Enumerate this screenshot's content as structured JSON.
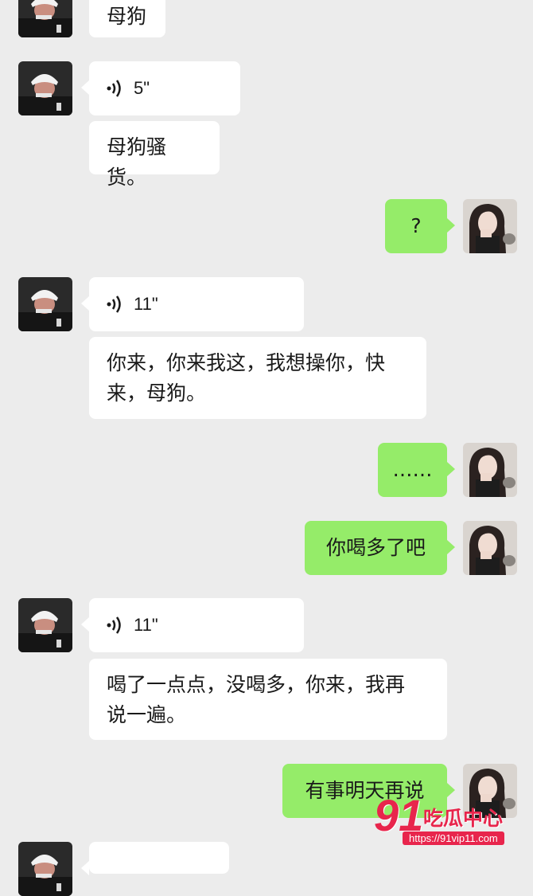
{
  "chat": {
    "messages": [
      {
        "sender": "other",
        "type": "text",
        "text": "母狗"
      },
      {
        "sender": "other",
        "type": "voice",
        "duration": "5\""
      },
      {
        "sender": "other",
        "type": "text",
        "text": "母狗骚货。"
      },
      {
        "sender": "self",
        "type": "text",
        "text": "?"
      },
      {
        "sender": "other",
        "type": "voice",
        "duration": "11\""
      },
      {
        "sender": "other",
        "type": "text",
        "line1": "你来，你来我这，我想操你，快",
        "line2": "来，母狗。"
      },
      {
        "sender": "self",
        "type": "text",
        "text": "……"
      },
      {
        "sender": "self",
        "type": "text",
        "text": "你喝多了吧"
      },
      {
        "sender": "other",
        "type": "voice",
        "duration": "11\""
      },
      {
        "sender": "other",
        "type": "text",
        "line1": "喝了一点点，没喝多，你来，我再",
        "line2": "说一遍。"
      },
      {
        "sender": "self",
        "type": "text",
        "text": "有事明天再说"
      }
    ]
  },
  "icons": {
    "voice": "voice-wave-icon",
    "avatar_other": "avatar-man-white-cap",
    "avatar_self": "avatar-woman-long-hair"
  },
  "colors": {
    "background": "#ececec",
    "incoming_bubble": "#ffffff",
    "outgoing_bubble": "#95ec69",
    "watermark": "#e8254c"
  },
  "watermark": {
    "logo": "91",
    "title": "吃瓜中心",
    "url": "https://91vip11.com"
  }
}
